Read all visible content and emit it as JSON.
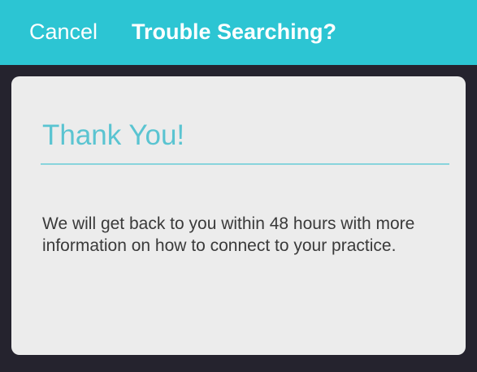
{
  "navbar": {
    "cancel_label": "Cancel",
    "title": "Trouble Searching?",
    "background_color": "#2cc5d3"
  },
  "card": {
    "title": "Thank You!",
    "message": "We will get back to you within 48 hours with more information on how to connect to your practice.",
    "accent_color": "#5ac4d1"
  }
}
